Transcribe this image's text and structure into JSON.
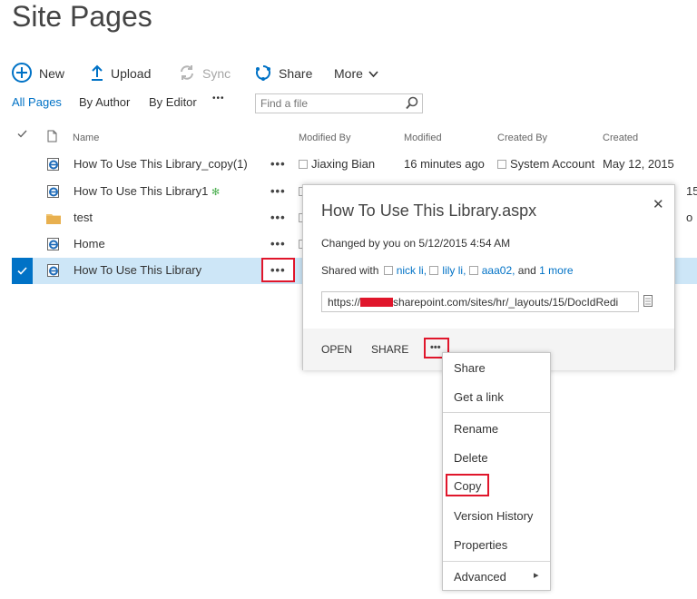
{
  "page": {
    "title": "Site Pages"
  },
  "commands": {
    "new": "New",
    "upload": "Upload",
    "sync": "Sync",
    "share": "Share",
    "more": "More"
  },
  "views": {
    "all_pages": "All Pages",
    "by_author": "By Author",
    "by_editor": "By Editor",
    "more": "•••"
  },
  "search": {
    "placeholder": "Find a file"
  },
  "columns": {
    "name": "Name",
    "modified_by": "Modified By",
    "modified": "Modified",
    "created_by": "Created By",
    "created": "Created"
  },
  "rows": [
    {
      "name": "How To Use This Library_copy(1)",
      "type": "page",
      "modified_by": "Jiaxing Bian",
      "modified": "16 minutes ago",
      "created_by": "System Account",
      "created": "May 12, 2015",
      "selected": false
    },
    {
      "name": "How To Use This Library1",
      "type": "page",
      "new_badge": "✻",
      "created_tail": "15",
      "selected": false
    },
    {
      "name": "test",
      "type": "folder",
      "created_tail": "o",
      "selected": false
    },
    {
      "name": "Home",
      "type": "page",
      "selected": false
    },
    {
      "name": "How To Use This Library",
      "type": "page",
      "selected": true
    }
  ],
  "ellipsis": "•••",
  "callout": {
    "title": "How To Use This Library.aspx",
    "changed": "Changed by you on 5/12/2015 4:54 AM",
    "shared_prefix": "Shared with",
    "shared_users": [
      "nick li,",
      "lily li,",
      "aaa02,"
    ],
    "shared_and": "and",
    "shared_more": "1 more",
    "url_prefix": "https://",
    "url_rest": "sharepoint.com/sites/hr/_layouts/15/DocIdRedi",
    "actions": {
      "open": "OPEN",
      "share": "SHARE",
      "more": "•••"
    },
    "close": "✕"
  },
  "menu": {
    "items": [
      "Share",
      "Get a link",
      "Rename",
      "Delete",
      "Copy",
      "Version History",
      "Properties",
      "Advanced"
    ],
    "submenu_arrow": "▸"
  },
  "colors": {
    "accent": "#0072c6",
    "highlight": "#e0162b",
    "selected_row": "#cde6f7"
  }
}
